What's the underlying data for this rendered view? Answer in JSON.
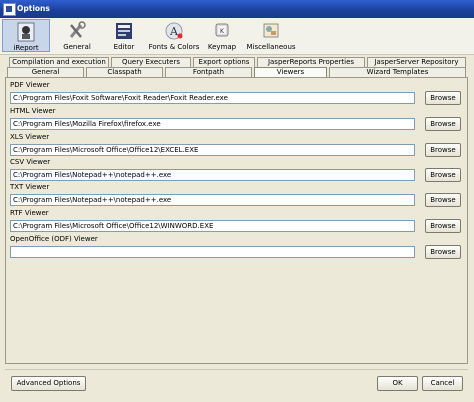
{
  "window": {
    "title": "Options"
  },
  "toolbar": {
    "items": [
      {
        "label": "iReport",
        "icon": "ireport-icon",
        "selected": true
      },
      {
        "label": "General",
        "icon": "general-tools-icon",
        "selected": false
      },
      {
        "label": "Editor",
        "icon": "editor-icon",
        "selected": false
      },
      {
        "label": "Fonts & Colors",
        "icon": "fonts-colors-icon",
        "selected": false
      },
      {
        "label": "Keymap",
        "icon": "keymap-icon",
        "selected": false
      },
      {
        "label": "Miscellaneous",
        "icon": "miscellaneous-icon",
        "selected": false
      }
    ]
  },
  "tabs": {
    "row1": [
      "Compilation and execution",
      "Query Executers",
      "Export options",
      "JasperReports Properties",
      "JasperServer Repository"
    ],
    "row2": [
      "General",
      "Classpath",
      "Fontpath",
      "Viewers",
      "Wizard Templates"
    ],
    "active": "Viewers"
  },
  "viewers": [
    {
      "label": "PDF Viewer",
      "value": "C:\\Program Files\\Foxit Software\\Foxit Reader\\Foxit Reader.exe",
      "button": "Browse"
    },
    {
      "label": "HTML Viewer",
      "value": "C:\\Program Files\\Mozilla Firefox\\firefox.exe",
      "button": "Browse"
    },
    {
      "label": "XLS Viewer",
      "value": "C:\\Program Files\\Microsoft Office\\Office12\\EXCEL.EXE",
      "button": "Browse"
    },
    {
      "label": "CSV Viewer",
      "value": "C:\\Program Files\\Notepad++\\notepad++.exe",
      "button": "Browse"
    },
    {
      "label": "TXT Viewer",
      "value": "C:\\Program Files\\Notepad++\\notepad++.exe",
      "button": "Browse"
    },
    {
      "label": "RTF Viewer",
      "value": "C:\\Program Files\\Microsoft Office\\Office12\\WINWORD.EXE",
      "button": "Browse"
    },
    {
      "label": "OpenOffice (ODF) Viewer",
      "value": "",
      "button": "Browse"
    }
  ],
  "footer": {
    "advanced": "Advanced Options",
    "ok": "OK",
    "cancel": "Cancel"
  },
  "colors": {
    "titlebar": "#1b3f9a",
    "selected_toolbar": "#c9d6ea",
    "dialog_bg": "#ece9d8"
  }
}
